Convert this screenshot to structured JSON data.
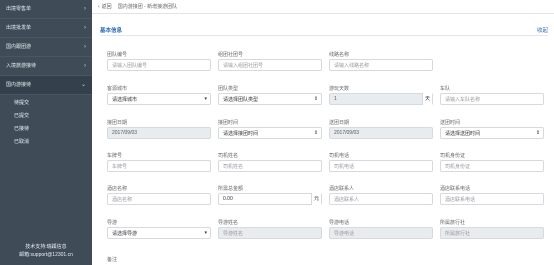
{
  "sidebar": {
    "groups": [
      {
        "label": "出境零售单"
      },
      {
        "label": "出境批发单"
      },
      {
        "label": "国内跟团游"
      },
      {
        "label": "入境旅游接待"
      },
      {
        "label": "国内游接待"
      }
    ],
    "subitems": [
      "待提交",
      "已提交",
      "已接待",
      "已取消"
    ],
    "footer_line1": "技术支持:瑞蹊信息",
    "footer_line2": "邮箱:support@12301.cn"
  },
  "topbar": {
    "back_label": "返回",
    "breadcrumb": "国内游接团 - 新增接游团队"
  },
  "section": {
    "title": "基本信息",
    "collapse_label": "收起"
  },
  "fields": {
    "team_no": {
      "label": "团队编号",
      "placeholder": "请输入团队编号"
    },
    "group_no": {
      "label": "组团社团号",
      "placeholder": "请输入组团社团号"
    },
    "route_name": {
      "label": "线路名称",
      "placeholder": "请输入线路名称"
    },
    "source_city": {
      "label": "客源城市",
      "value": "请选择城市"
    },
    "team_type": {
      "label": "团队类型",
      "value": "请选择团队类型"
    },
    "tour_days": {
      "label": "游玩天数",
      "value": "1",
      "suffix": "天"
    },
    "fleet": {
      "label": "车队",
      "placeholder": "请输入车队名称"
    },
    "pickup_date": {
      "label": "接团日期",
      "value": "2017/09/03"
    },
    "pickup_time": {
      "label": "接团时间",
      "value": "请选择接团时间"
    },
    "dropoff_date": {
      "label": "送团日期",
      "value": "2017/09/03"
    },
    "dropoff_time": {
      "label": "送团时间",
      "value": "请选择送团时间"
    },
    "plate_no": {
      "label": "车牌号",
      "placeholder": "车牌号"
    },
    "driver_name": {
      "label": "司机姓名",
      "placeholder": "司机姓名"
    },
    "driver_phone": {
      "label": "司机电话",
      "placeholder": "司机电话"
    },
    "driver_id": {
      "label": "司机身份证",
      "placeholder": "司机身份证"
    },
    "hotel_name": {
      "label": "酒店名称",
      "placeholder": "酒店名称"
    },
    "cash_amount": {
      "label": "所需总金额",
      "value": "0.00",
      "suffix": "元"
    },
    "hotel_contact": {
      "label": "酒店联系人",
      "placeholder": "酒店联系人"
    },
    "hotel_phone": {
      "label": "酒店联系电话",
      "placeholder": "酒店联系电话"
    },
    "guide": {
      "label": "导游",
      "value": "请选择导游"
    },
    "guide_name": {
      "label": "导游姓名",
      "value": "导游姓名"
    },
    "guide_phone": {
      "label": "导游电话",
      "value": "导游电话"
    },
    "agency": {
      "label": "所属旅行社",
      "value": "所属旅行社"
    }
  },
  "remark_label": "备注",
  "colors": {
    "sidebar_bg": "#3f4b57",
    "accent": "#2b6db3"
  }
}
